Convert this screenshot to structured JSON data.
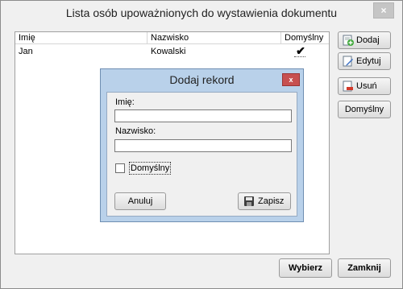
{
  "window": {
    "title": "Lista osób upoważnionych do wystawienia dokumentu",
    "close_glyph": "×"
  },
  "list": {
    "columns": [
      "Imię",
      "Nazwisko",
      "Domyślny"
    ],
    "rows": [
      {
        "first_name": "Jan",
        "last_name": "Kowalski",
        "default_mark": "✔"
      }
    ]
  },
  "side_buttons": {
    "add": "Dodaj",
    "edit": "Edytuj",
    "delete": "Usuń",
    "default": "Domyślny"
  },
  "bottom_buttons": {
    "select": "Wybierz",
    "close": "Zamknij"
  },
  "dialog": {
    "title": "Dodaj rekord",
    "close_glyph": "x",
    "first_name_label": "Imię:",
    "first_name_value": "",
    "last_name_label": "Nazwisko:",
    "last_name_value": "",
    "default_checkbox_label": "Domyślny",
    "cancel_label": "Anuluj",
    "save_label": "Zapisz"
  },
  "icons": {
    "add": "add-record-icon",
    "edit": "edit-pencil-icon",
    "delete": "delete-record-icon",
    "save": "floppy-disk-icon"
  },
  "colors": {
    "dialog_frame": "#b9d1ea",
    "close_red": "#c75050",
    "window_bg": "#f0f0f0"
  }
}
